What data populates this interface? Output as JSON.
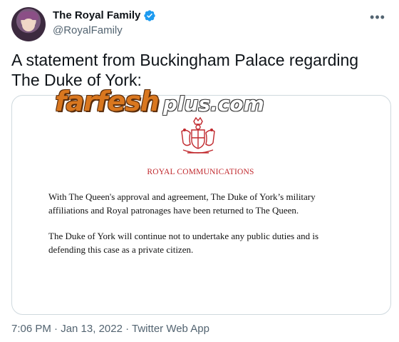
{
  "tweet": {
    "display_name": "The Royal Family",
    "handle": "@RoyalFamily",
    "text": "A statement from Buckingham Palace regarding The Duke of York:",
    "timestamp": "7:06 PM · Jan 13, 2022 · Twitter Web App"
  },
  "media": {
    "watermark_main": "farfesh",
    "watermark_sub": "plus.com",
    "heading": "ROYAL COMMUNICATIONS",
    "paragraph_1": "With The Queen's approval and agreement, The Duke of York’s military affiliations and Royal patronages have been returned to The Queen.",
    "paragraph_2": "The Duke of York will continue not to undertake any public duties and is defending this case as a private citizen."
  },
  "icons": {
    "verified": "verified-badge-icon",
    "more": "more-options-icon",
    "crest": "royal-coat-of-arms-icon"
  },
  "colors": {
    "verified": "#1d9bf0",
    "crest_red": "#c0282d",
    "secondary_text": "#536471",
    "watermark_orange": "#d9771f"
  }
}
